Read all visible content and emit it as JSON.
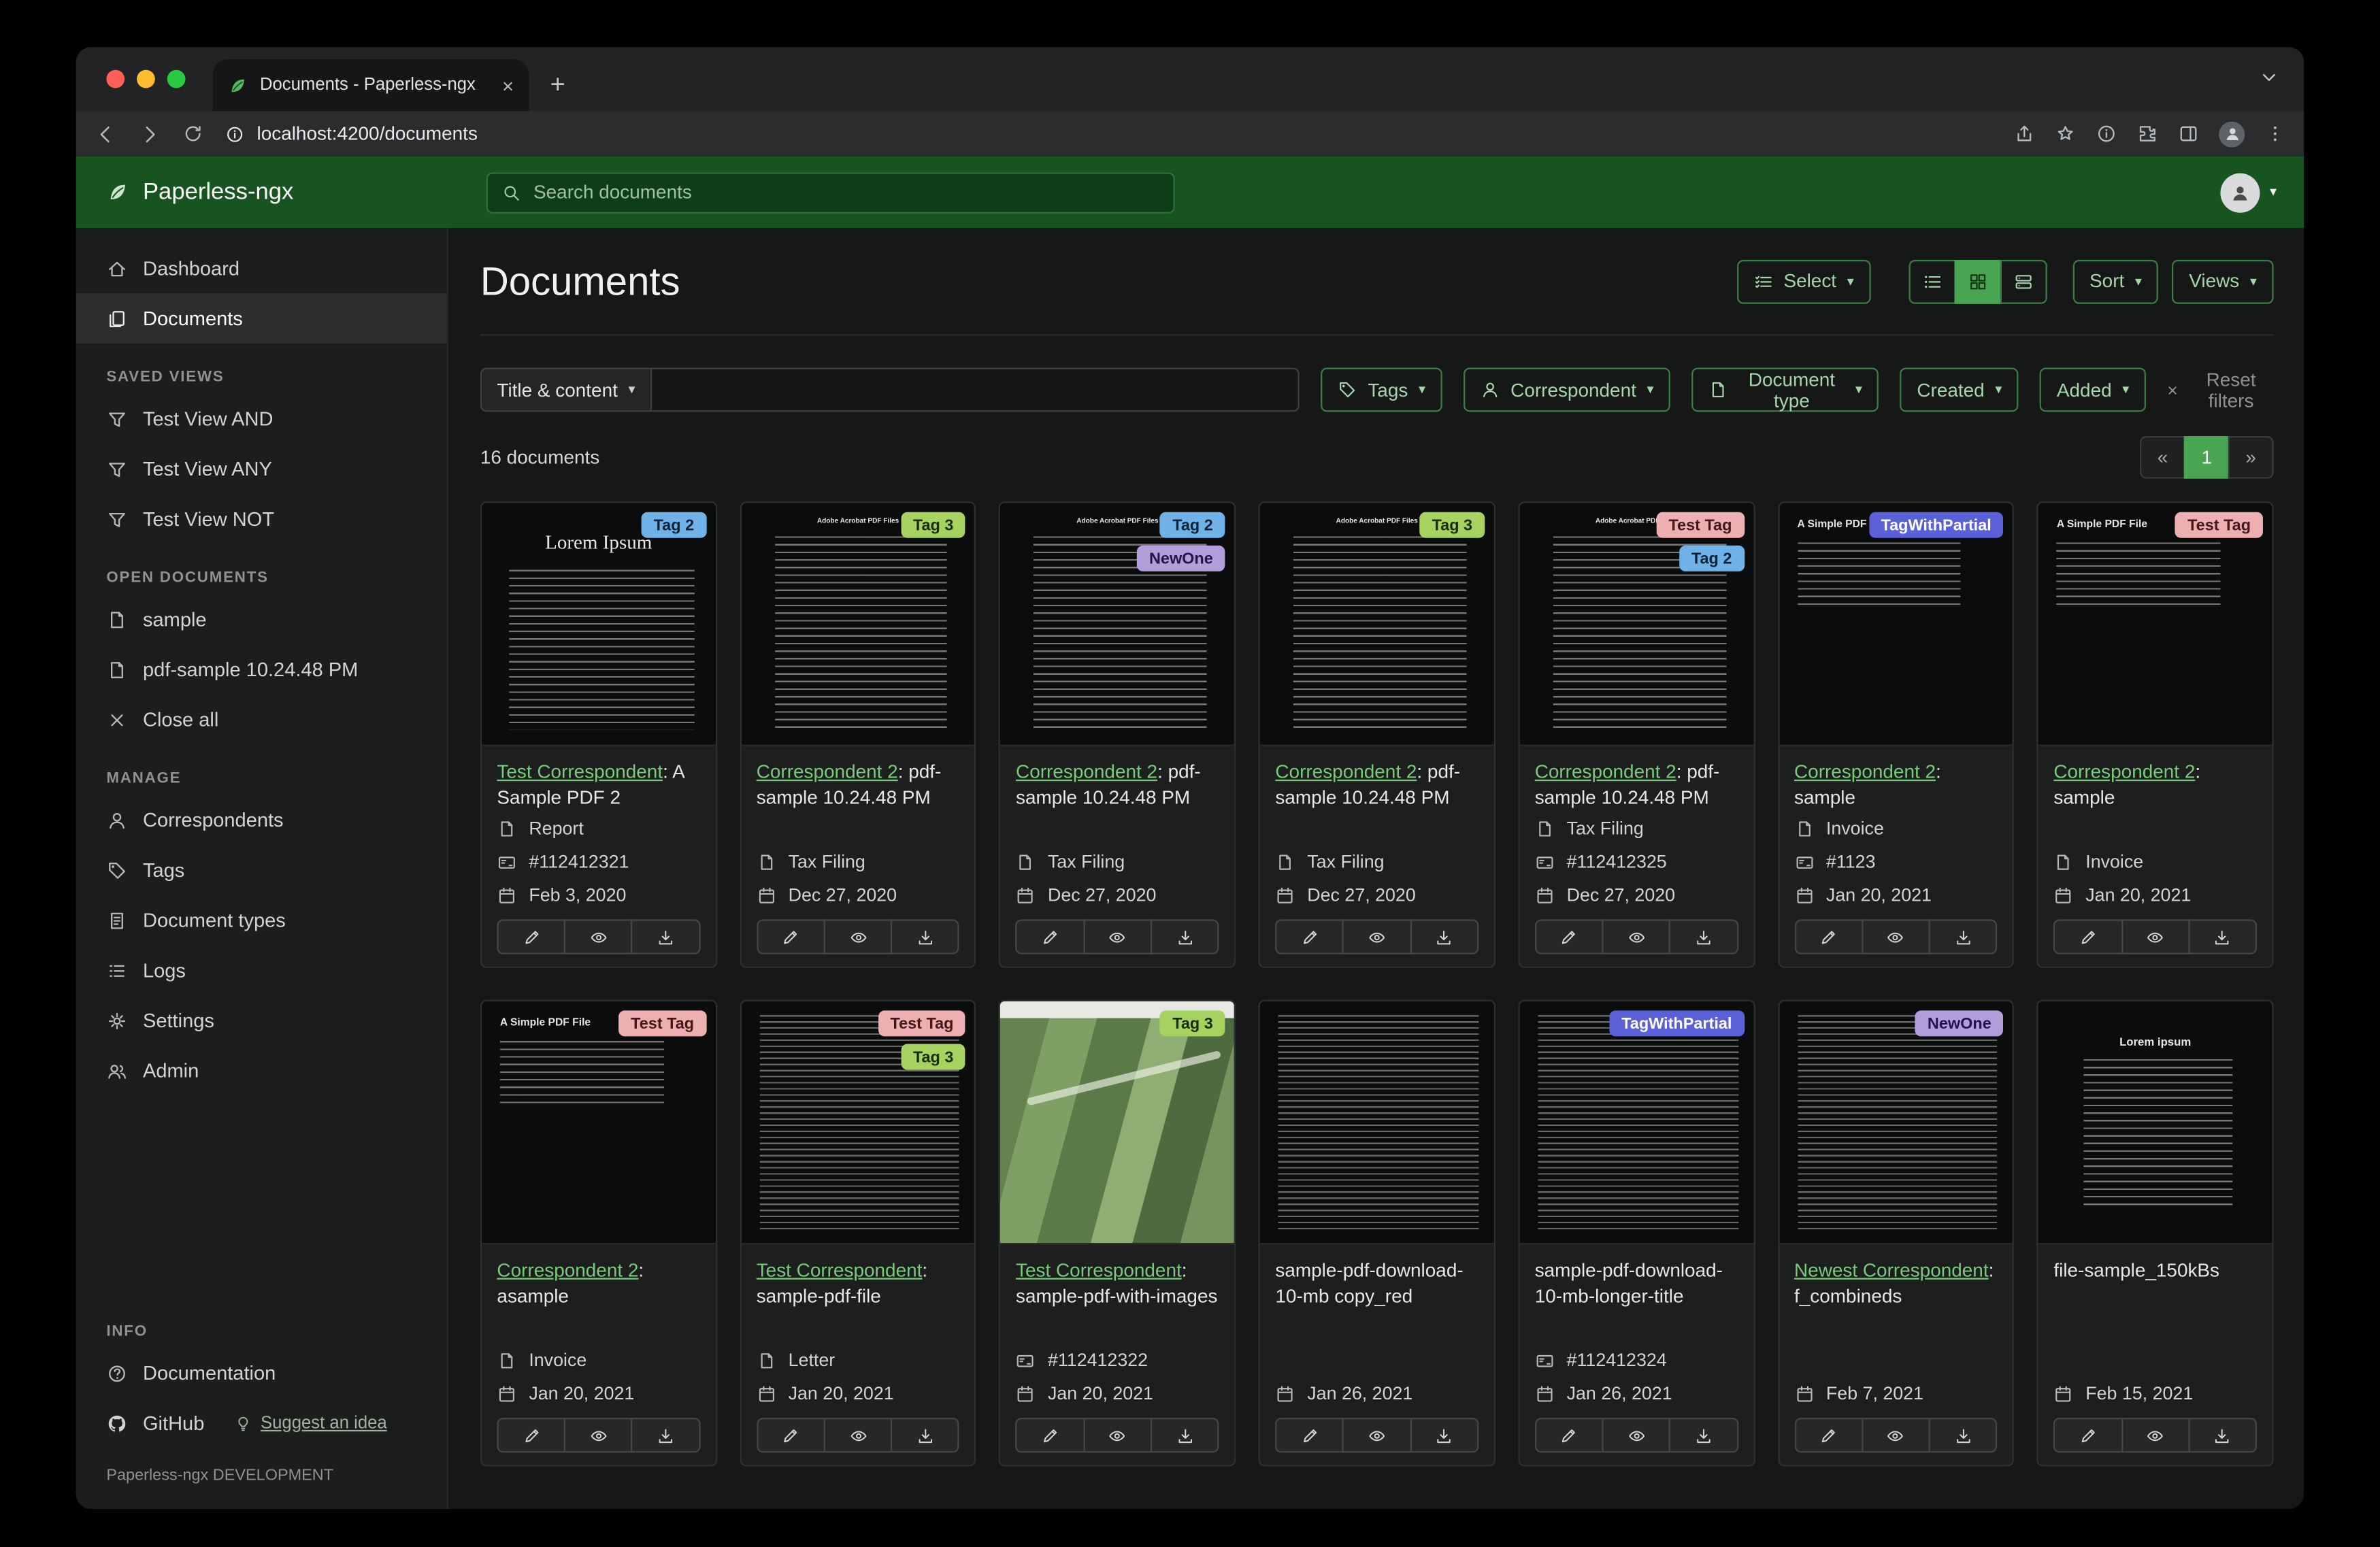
{
  "browser": {
    "tab_title": "Documents - Paperless-ngx",
    "url": "localhost:4200/documents"
  },
  "app_header": {
    "brand": "Paperless-ngx",
    "search_placeholder": "Search documents"
  },
  "sidebar": {
    "main": [
      "Dashboard",
      "Documents"
    ],
    "saved_views_title": "SAVED VIEWS",
    "saved_views": [
      "Test View AND",
      "Test View ANY",
      "Test View NOT"
    ],
    "open_documents_title": "OPEN DOCUMENTS",
    "open_documents": [
      "sample",
      "pdf-sample 10.24.48 PM"
    ],
    "close_all": "Close all",
    "manage_title": "MANAGE",
    "manage": [
      "Correspondents",
      "Tags",
      "Document types",
      "Logs",
      "Settings",
      "Admin"
    ],
    "info_title": "INFO",
    "documentation": "Documentation",
    "github": "GitHub",
    "suggest": "Suggest an idea",
    "footer": "Paperless-ngx DEVELOPMENT"
  },
  "main": {
    "title": "Documents",
    "select_label": "Select",
    "sort_label": "Sort",
    "views_label": "Views",
    "count": "16 documents",
    "pagination": {
      "prev": "«",
      "page": "1",
      "next": "»"
    }
  },
  "filters": {
    "title_content": "Title & content",
    "tags": "Tags",
    "correspondent": "Correspondent",
    "document_type": "Document type",
    "created": "Created",
    "added": "Added",
    "reset": "Reset filters"
  },
  "tag_styles": {
    "Tag 2": {
      "bg": "#6fb2e8",
      "fg": "#0c2236"
    },
    "Tag 3": {
      "bg": "#a6d35f",
      "fg": "#1d2b0d"
    },
    "NewOne": {
      "bg": "#b39ddb",
      "fg": "#241448"
    },
    "Test Tag": {
      "bg": "#eeafb1",
      "fg": "#43181a"
    },
    "TagWithPartial": {
      "bg": "#5a60d8",
      "fg": "#ffffff"
    }
  },
  "documents": [
    {
      "tags": [
        "Tag 2"
      ],
      "correspondent": "Test Correspondent",
      "title": ": A Sample PDF 2",
      "type": "Report",
      "asn": "#112412321",
      "date": "Feb 3, 2020",
      "thumb": {
        "variant": "lorem",
        "heading": "Lorem Ipsum"
      }
    },
    {
      "tags": [
        "Tag 3"
      ],
      "correspondent": "Correspondent 2",
      "title": ": pdf-sample 10.24.48 PM",
      "type": "Tax Filing",
      "asn": "",
      "date": "Dec 27, 2020",
      "thumb": {
        "variant": "adobe",
        "heading": "Adobe Acrobat PDF Files"
      }
    },
    {
      "tags": [
        "Tag 2",
        "NewOne"
      ],
      "correspondent": "Correspondent 2",
      "title": ": pdf-sample 10.24.48 PM",
      "type": "Tax Filing",
      "asn": "",
      "date": "Dec 27, 2020",
      "thumb": {
        "variant": "adobe",
        "heading": "Adobe Acrobat PDF Files"
      }
    },
    {
      "tags": [
        "Tag 3"
      ],
      "correspondent": "Correspondent 2",
      "title": ": pdf-sample 10.24.48 PM",
      "type": "Tax Filing",
      "asn": "",
      "date": "Dec 27, 2020",
      "thumb": {
        "variant": "adobe",
        "heading": "Adobe Acrobat PDF Files"
      }
    },
    {
      "tags": [
        "Test Tag",
        "Tag 2"
      ],
      "correspondent": "Correspondent 2",
      "title": ": pdf-sample 10.24.48 PM",
      "type": "Tax Filing",
      "asn": "#112412325",
      "date": "Dec 27, 2020",
      "thumb": {
        "variant": "adobe",
        "heading": "Adobe Acrobat PDF Files"
      }
    },
    {
      "tags": [
        "TagWithPartial"
      ],
      "correspondent": "Correspondent 2",
      "title": ": sample",
      "type": "Invoice",
      "asn": "#1123",
      "date": "Jan 20, 2021",
      "thumb": {
        "variant": "simple",
        "heading": "A Simple PDF File"
      }
    },
    {
      "tags": [
        "Test Tag"
      ],
      "correspondent": "Correspondent 2",
      "title": ": sample",
      "type": "Invoice",
      "asn": "",
      "date": "Jan 20, 2021",
      "thumb": {
        "variant": "simple",
        "heading": "A Simple PDF File"
      }
    },
    {
      "tags": [
        "Test Tag"
      ],
      "correspondent": "Correspondent 2",
      "title": ": asample",
      "type": "Invoice",
      "asn": "",
      "date": "Jan 20, 2021",
      "thumb": {
        "variant": "simple",
        "heading": "A Simple PDF File"
      }
    },
    {
      "tags": [
        "Test Tag",
        "Tag 3"
      ],
      "correspondent": "Test Correspondent",
      "title": ": sample-pdf-file",
      "type": "Letter",
      "asn": "",
      "date": "Jan 20, 2021",
      "thumb": {
        "variant": "dense",
        "heading": ""
      }
    },
    {
      "tags": [
        "Tag 3"
      ],
      "correspondent": "Test Correspondent",
      "title": ": sample-pdf-with-images",
      "type": "",
      "asn": "#112412322",
      "date": "Jan 20, 2021",
      "thumb": {
        "variant": "map",
        "heading": ""
      }
    },
    {
      "tags": [],
      "correspondent": "",
      "title": "sample-pdf-download-10-mb copy_red",
      "type": "",
      "asn": "",
      "date": "Jan 26, 2021",
      "thumb": {
        "variant": "dense",
        "heading": ""
      }
    },
    {
      "tags": [
        "TagWithPartial"
      ],
      "correspondent": "",
      "title": "sample-pdf-download-10-mb-longer-title",
      "type": "",
      "asn": "#112412324",
      "date": "Jan 26, 2021",
      "thumb": {
        "variant": "dense",
        "heading": ""
      }
    },
    {
      "tags": [
        "NewOne"
      ],
      "correspondent": "Newest Correspondent",
      "title": ": f_combineds",
      "type": "",
      "asn": "",
      "date": "Feb 7, 2021",
      "thumb": {
        "variant": "dense",
        "heading": ""
      }
    },
    {
      "tags": [],
      "correspondent": "",
      "title": "file-sample_150kBs",
      "type": "",
      "asn": "",
      "date": "Feb 15, 2021",
      "thumb": {
        "variant": "lorem_center",
        "heading": "Lorem ipsum"
      }
    }
  ]
}
